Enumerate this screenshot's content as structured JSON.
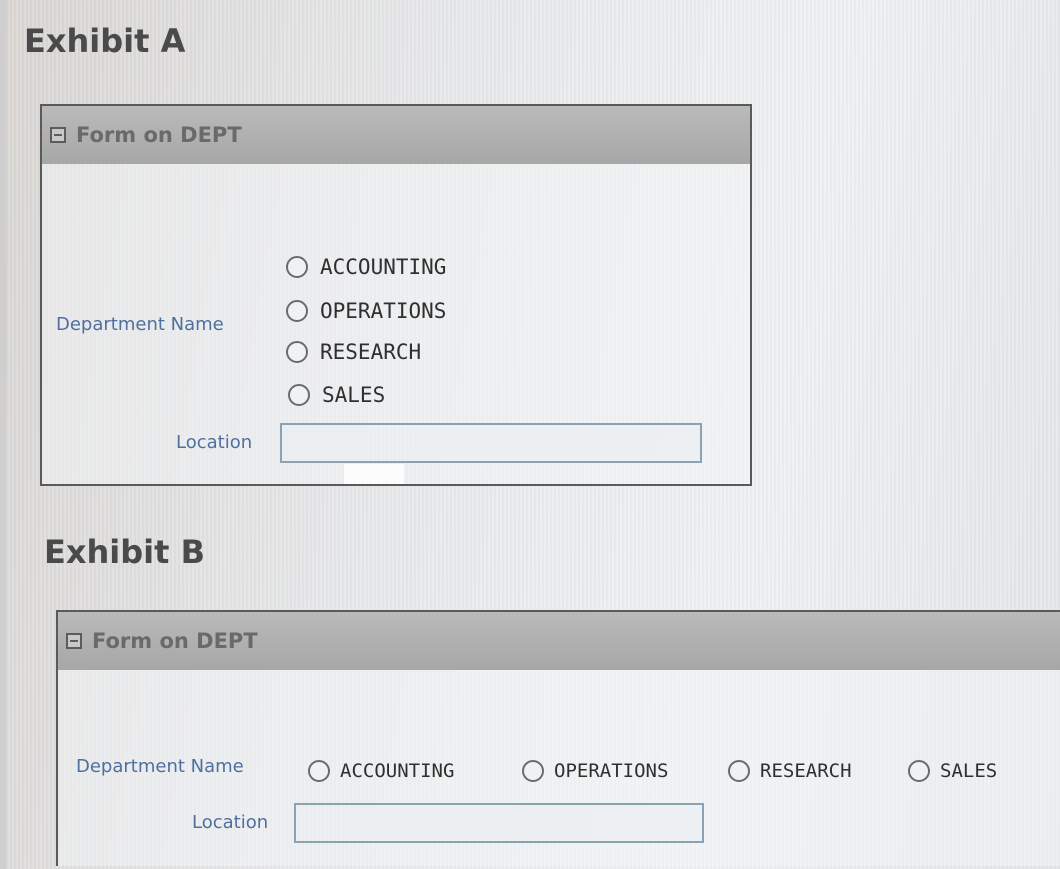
{
  "exhibit_a": {
    "title": "Exhibit A",
    "region_title": "Form on DEPT",
    "department_label": "Department Name",
    "location_label": "Location",
    "location_value": "",
    "options": [
      "ACCOUNTING",
      "OPERATIONS",
      "RESEARCH",
      "SALES"
    ]
  },
  "exhibit_b": {
    "title": "Exhibit B",
    "region_title": "Form on DEPT",
    "department_label": "Department Name",
    "location_label": "Location",
    "location_value": "",
    "options": [
      "ACCOUNTING",
      "OPERATIONS",
      "RESEARCH",
      "SALES"
    ]
  },
  "colors": {
    "label_blue": "#4e6fa0",
    "header_gray": "#a6a7a6",
    "border_dark": "#5a5a5a"
  },
  "icons": {
    "collapse": "collapse-minus-icon",
    "radio": "radio-button-icon"
  }
}
